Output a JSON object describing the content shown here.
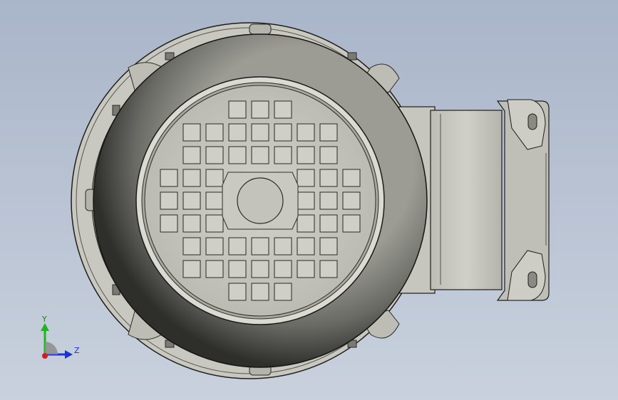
{
  "viewport": {
    "background_top": "#a9b5c9",
    "background_bottom": "#c9d1dd",
    "model": {
      "name": "motor",
      "view": "end-view",
      "colors": {
        "body": "#c9c9c1",
        "body_dark": "#6d6d68",
        "edge": "#1e1e1c",
        "fan_cover_light": "#a2a29b",
        "fan_cover_dark": "#3c3c38"
      }
    }
  },
  "triad": {
    "y_label": "Y",
    "z_label": "Z",
    "colors": {
      "y": "#1fb51f",
      "z": "#1a32d6",
      "x": "#d41c1c"
    }
  }
}
